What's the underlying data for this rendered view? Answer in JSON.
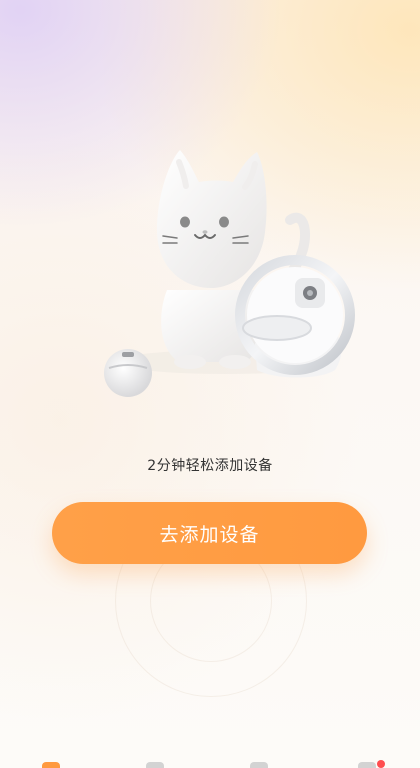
{
  "main": {
    "subtitle": "2分钟轻松添加设备",
    "add_button_label": "去添加设备"
  },
  "illustration": {
    "icon": "cat-with-smart-feeder-illustration"
  },
  "colors": {
    "accent": "#ff9a40",
    "badge": "#ff4d4f"
  },
  "tabbar": {
    "tabs": [
      {
        "icon": "home-icon",
        "active": true
      },
      {
        "icon": "message-icon",
        "active": false
      },
      {
        "icon": "device-icon",
        "active": false
      },
      {
        "icon": "profile-icon",
        "active": false
      }
    ]
  }
}
